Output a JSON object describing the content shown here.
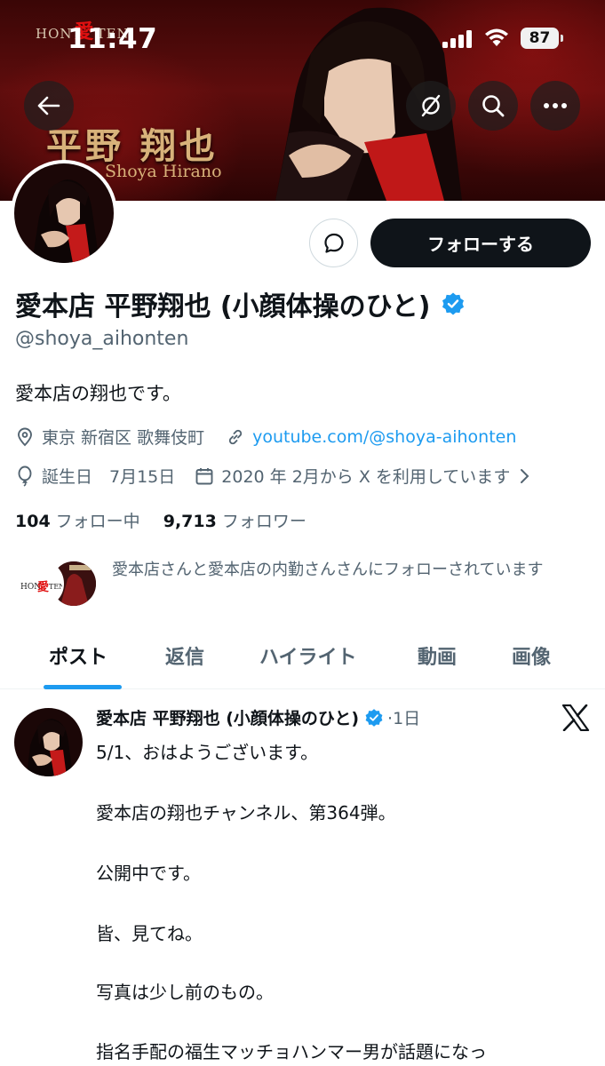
{
  "status_bar": {
    "time": "11:47",
    "battery": "87"
  },
  "banner": {
    "logo_left": "HON",
    "logo_mark": "愛",
    "logo_right": "TEN",
    "name": "平野 翔也",
    "roman_name": "Shoya Hirano"
  },
  "nav": {
    "back_icon": "arrow-left-icon",
    "filter_icon": "hide-reposts-icon",
    "search_icon": "search-icon",
    "more_icon": "more-icon"
  },
  "profile": {
    "message_icon": "message-icon",
    "follow_label": "フォローする",
    "display_name": "愛本店 平野翔也 (小顔体操のひと)",
    "handle": "@shoya_aihonten",
    "bio": "愛本店の翔也です。",
    "location": "東京 新宿区 歌舞伎町",
    "link": "youtube.com/@shoya-aihonten",
    "birthday": "誕生日　7月15日",
    "joined": "2020 年 2月から X を利用しています",
    "following_count": "104",
    "following_label": "フォロー中",
    "followers_count": "9,713",
    "followers_label": "フォロワー",
    "followed_by": "愛本店さんと愛本店の内勤さんさんにフォローされています",
    "colors": {
      "accent": "#1d9bf0",
      "text_secondary": "#536471",
      "button_dark": "#0f1419"
    }
  },
  "tabs": [
    {
      "label": "ポスト",
      "active": true
    },
    {
      "label": "返信",
      "active": false
    },
    {
      "label": "ハイライト",
      "active": false
    },
    {
      "label": "動画",
      "active": false
    },
    {
      "label": "画像",
      "active": false
    }
  ],
  "post": {
    "author": "愛本店 平野翔也 (小顔体操のひと)",
    "time": "·1日",
    "lines": [
      "5/1、おはようございます。",
      "愛本店の翔也チャンネル、第364弾。",
      "公開中です。",
      "皆、見てね。",
      "写真は少し前のもの。",
      "指名手配の福生マッチョハンマー男が話題になっ"
    ]
  }
}
